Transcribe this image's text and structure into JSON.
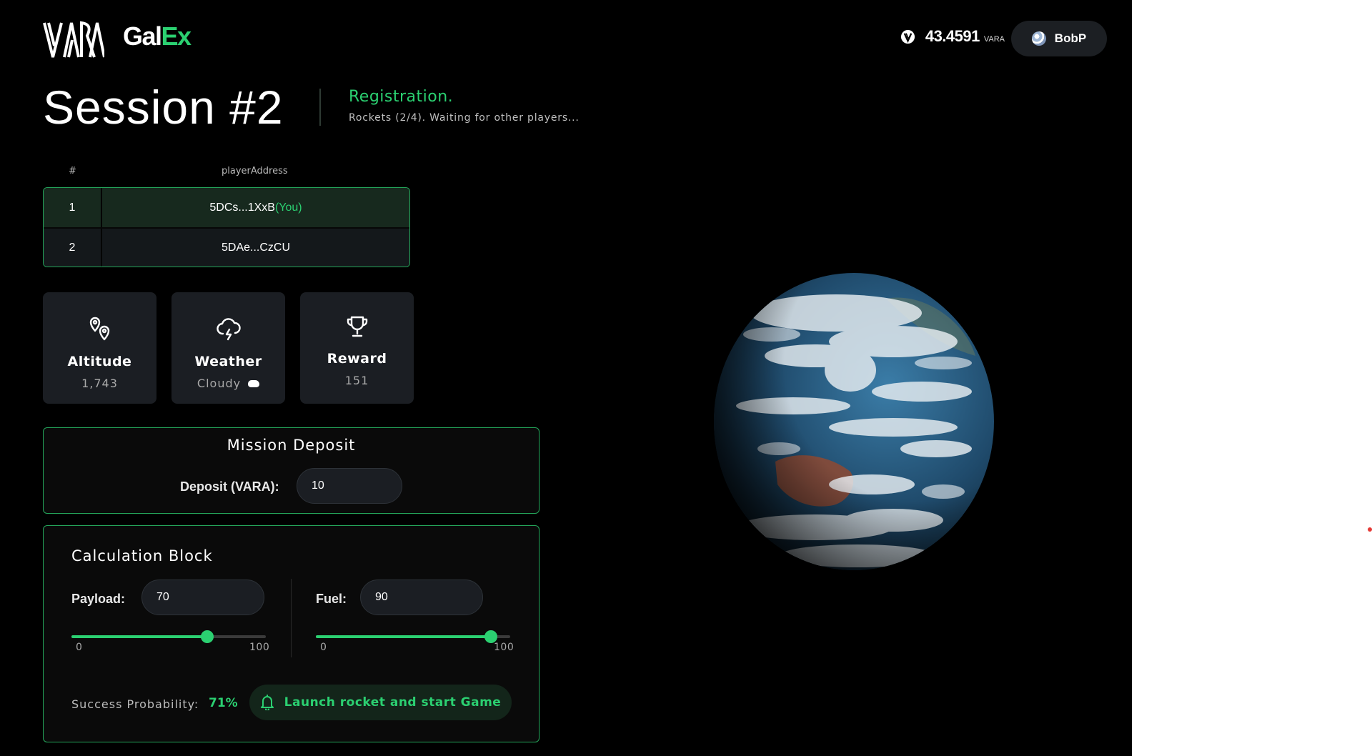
{
  "header": {
    "logo_vara": "VARA",
    "logo_galex_main": "Gal",
    "logo_galex_accent": "Ex",
    "balance_amount": "43.4591",
    "balance_unit": "VARA",
    "account_name": "BobP"
  },
  "session": {
    "title": "Session #2",
    "status": "Registration.",
    "status_detail": "Rockets (2/4). Waiting for other players..."
  },
  "players": {
    "columns": [
      "#",
      "playerAddress"
    ],
    "rows": [
      {
        "num": "1",
        "address": "5DCs...1XxB",
        "tag": "(You)"
      },
      {
        "num": "2",
        "address": "5DAe...CzCU",
        "tag": ""
      }
    ]
  },
  "stats": {
    "altitude": {
      "label": "Altitude",
      "value": "1,743",
      "icon": "map-pins-icon"
    },
    "weather": {
      "label": "Weather",
      "value": "Cloudy",
      "icon": "cloud-lightning-icon"
    },
    "reward": {
      "label": "Reward",
      "value": "151",
      "icon": "trophy-icon"
    }
  },
  "mission": {
    "title": "Mission Deposit",
    "deposit_label": "Deposit (VARA):",
    "deposit_value": "10"
  },
  "calc": {
    "title": "Calculation Block",
    "payload_label": "Payload:",
    "payload_value": "70",
    "payload_level": 0.7,
    "fuel_label": "Fuel:",
    "fuel_value": "90",
    "fuel_level": 0.9,
    "range_min": "0",
    "range_max": "100",
    "probability_label": "Success Probability:",
    "probability_value": "71%",
    "launch_label": "Launch rocket and start Game"
  },
  "colors": {
    "accent": "#2bd071",
    "background": "#000000",
    "card": "#1b1e23",
    "border_green": "#24a55a",
    "ocean": "#1f4a6b",
    "land": "#8a4a36"
  }
}
